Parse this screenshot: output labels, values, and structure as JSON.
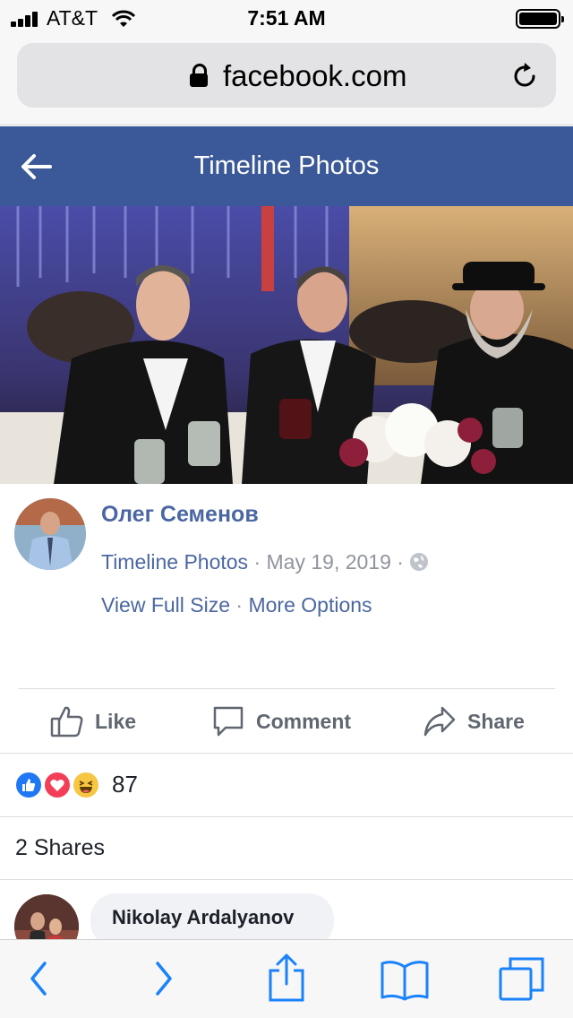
{
  "status_bar": {
    "carrier": "AT&T",
    "time": "7:51 AM"
  },
  "browser": {
    "url": "facebook.com"
  },
  "header": {
    "title": "Timeline Photos"
  },
  "post": {
    "author": "Олег Семенов",
    "album": "Timeline Photos",
    "separator": "·",
    "date": "May 19, 2019",
    "view_full_size": "View Full Size",
    "more_options": "More Options"
  },
  "actions": {
    "like": "Like",
    "comment": "Comment",
    "share": "Share"
  },
  "reactions": {
    "count": "87",
    "types": [
      "like",
      "love",
      "haha"
    ]
  },
  "shares": {
    "text": "2 Shares"
  },
  "comments": [
    {
      "name": "Nikolay Ardalyanov"
    }
  ],
  "colors": {
    "facebook_blue": "#3b5998",
    "link": "#4b67a1",
    "ios_blue": "#1a82fb"
  }
}
